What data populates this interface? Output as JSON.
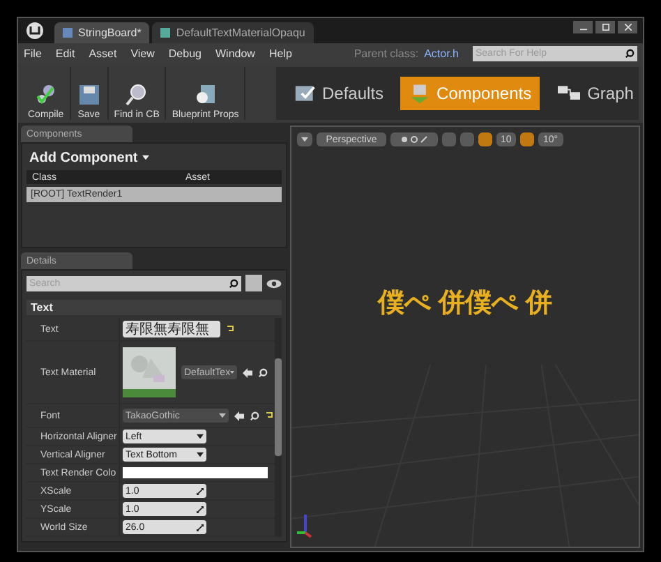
{
  "window": {
    "tabs": [
      {
        "label": "StringBoard*",
        "selected": true
      },
      {
        "label": "DefaultTextMaterialOpaqu",
        "selected": false
      }
    ],
    "parent_class_label": "Parent class:",
    "parent_class_link": "Actor.h",
    "help_search": {
      "placeholder": "Search For Help"
    }
  },
  "menu": [
    "File",
    "Edit",
    "Asset",
    "View",
    "Debug",
    "Window",
    "Help"
  ],
  "toolbar": {
    "buttons": [
      {
        "label": "Compile",
        "kind": "compile"
      },
      {
        "label": "Save",
        "kind": "save"
      },
      {
        "label": "Find in CB",
        "kind": "find"
      },
      {
        "label": "Blueprint Props",
        "kind": "props"
      }
    ],
    "modes": [
      {
        "label": "Defaults",
        "kind": "defaults",
        "selected": false
      },
      {
        "label": "Components",
        "kind": "components",
        "selected": true
      },
      {
        "label": "Graph",
        "kind": "graph",
        "selected": false
      }
    ]
  },
  "components_panel": {
    "tab": "Components",
    "add_button": "Add Component",
    "columns": [
      "Class",
      "Asset"
    ],
    "rows": [
      {
        "label": "[ROOT] TextRender1",
        "selected": true
      }
    ]
  },
  "details_panel": {
    "tab": "Details",
    "search": {
      "placeholder": "Search"
    },
    "section": "Text",
    "properties": [
      {
        "label": "Text",
        "kind": "text",
        "value": "寿限無寿限無"
      },
      {
        "label": "Text Material",
        "kind": "material",
        "value": "DefaultTex"
      },
      {
        "label": "Font",
        "kind": "font",
        "value": "TakaoGothic"
      },
      {
        "label": "Horizontal Aligner",
        "kind": "dropdown",
        "value": "Left"
      },
      {
        "label": "Vertical Aligner",
        "kind": "dropdown",
        "value": "Text Bottom"
      },
      {
        "label": "Text Render Colo",
        "kind": "color"
      },
      {
        "label": "XScale",
        "kind": "number",
        "value": "1.0"
      },
      {
        "label": "YScale",
        "kind": "number",
        "value": "1.0"
      },
      {
        "label": "World Size",
        "kind": "number",
        "value": "26.0"
      }
    ]
  },
  "viewport": {
    "view_mode": "Perspective",
    "grid_snap": "10",
    "rotation_snap": "10°",
    "text": "僕ぺ 併僕ぺ 併"
  }
}
